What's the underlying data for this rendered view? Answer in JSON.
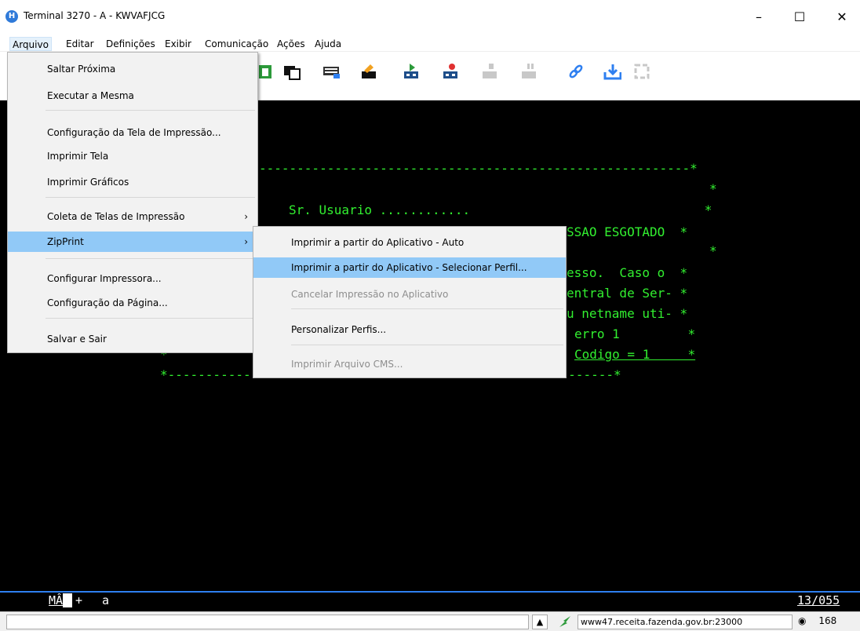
{
  "window": {
    "title": "Terminal 3270 - A - KWVAFJCG",
    "icon_letter": "H"
  },
  "menubar": [
    "Arquivo",
    "Editar",
    "Definições",
    "Exibir",
    "Comunicação",
    "Ações",
    "Ajuda"
  ],
  "file_menu": [
    "Saltar Próxima",
    "Executar a Mesma",
    "Configuração da Tela de Impressão...",
    "Imprimir Tela",
    "Imprimir Gráficos",
    "Coleta de Telas de Impressão",
    "ZipPrint",
    "Configurar Impressora...",
    "Configuração da Página...",
    "Salvar e Sair"
  ],
  "zipprint_menu": [
    "Imprimir a partir do Aplicativo - Auto",
    "Imprimir a partir do Aplicativo - Selecionar Perfil...",
    "Cancelar Impressão no Aplicativo",
    "Personalizar Perfis...",
    "Imprimir Arquivo CMS..."
  ],
  "terminal_lines": [
    "---------------------------------------------------------*",
    "*",
    "Sr. Usuario ............                               *",
    "SSAO ESGOTADO  *",
    "*",
    "esso.  Caso o  *",
    "entral de Ser- *",
    "u netname uti- *",
    "erro 1         *",
    "Codigo = 1     *",
    "*",
    "*-----------------------------------------------------------*"
  ],
  "oia": {
    "left": "MÂ",
    "plus": "+",
    "a": "a",
    "cursor_pos": "13/055"
  },
  "statusbar": {
    "host": "www47.receita.fazenda.gov.br:23000",
    "number": "168"
  },
  "colors": {
    "terminal_text": "#32f030",
    "highlight": "#91c9f7",
    "oia_border": "#2e7ff0"
  }
}
